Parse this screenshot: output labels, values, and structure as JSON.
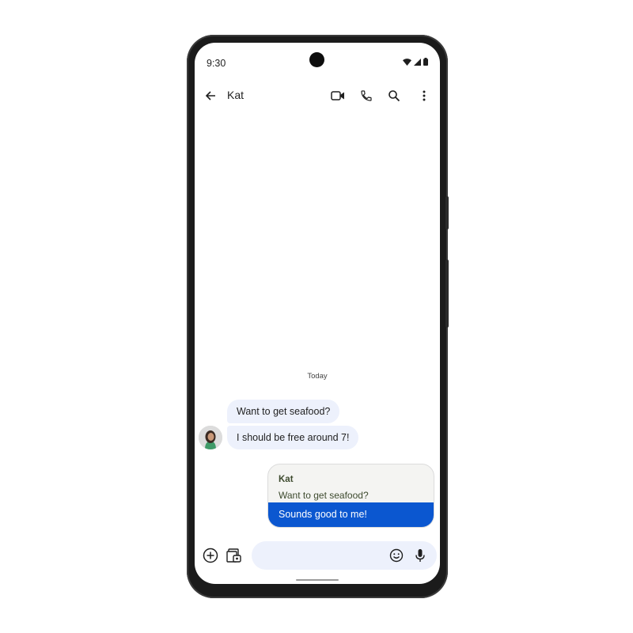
{
  "status_bar": {
    "time": "9:30",
    "icons": [
      "wifi-icon",
      "signal-icon",
      "battery-icon"
    ]
  },
  "app_bar": {
    "back_icon": "arrow-left-icon",
    "title": "Kat",
    "actions": [
      "video-call-icon",
      "phone-icon",
      "search-icon",
      "more-vert-icon"
    ]
  },
  "conversation": {
    "date_divider": "Today",
    "incoming": [
      {
        "text": "Want to get seafood?"
      },
      {
        "text": "I should be free around 7!"
      }
    ],
    "reply": {
      "quoted_sender": "Kat",
      "quoted_text": "Want to get seafood?",
      "text": "Sounds good to me!"
    }
  },
  "composer": {
    "placeholder": "",
    "icons": [
      "add-circle-icon",
      "gallery-icon",
      "emoji-icon",
      "mic-icon"
    ]
  },
  "colors": {
    "accent": "#0b57d0",
    "incoming_bubble": "#edf1fc"
  }
}
